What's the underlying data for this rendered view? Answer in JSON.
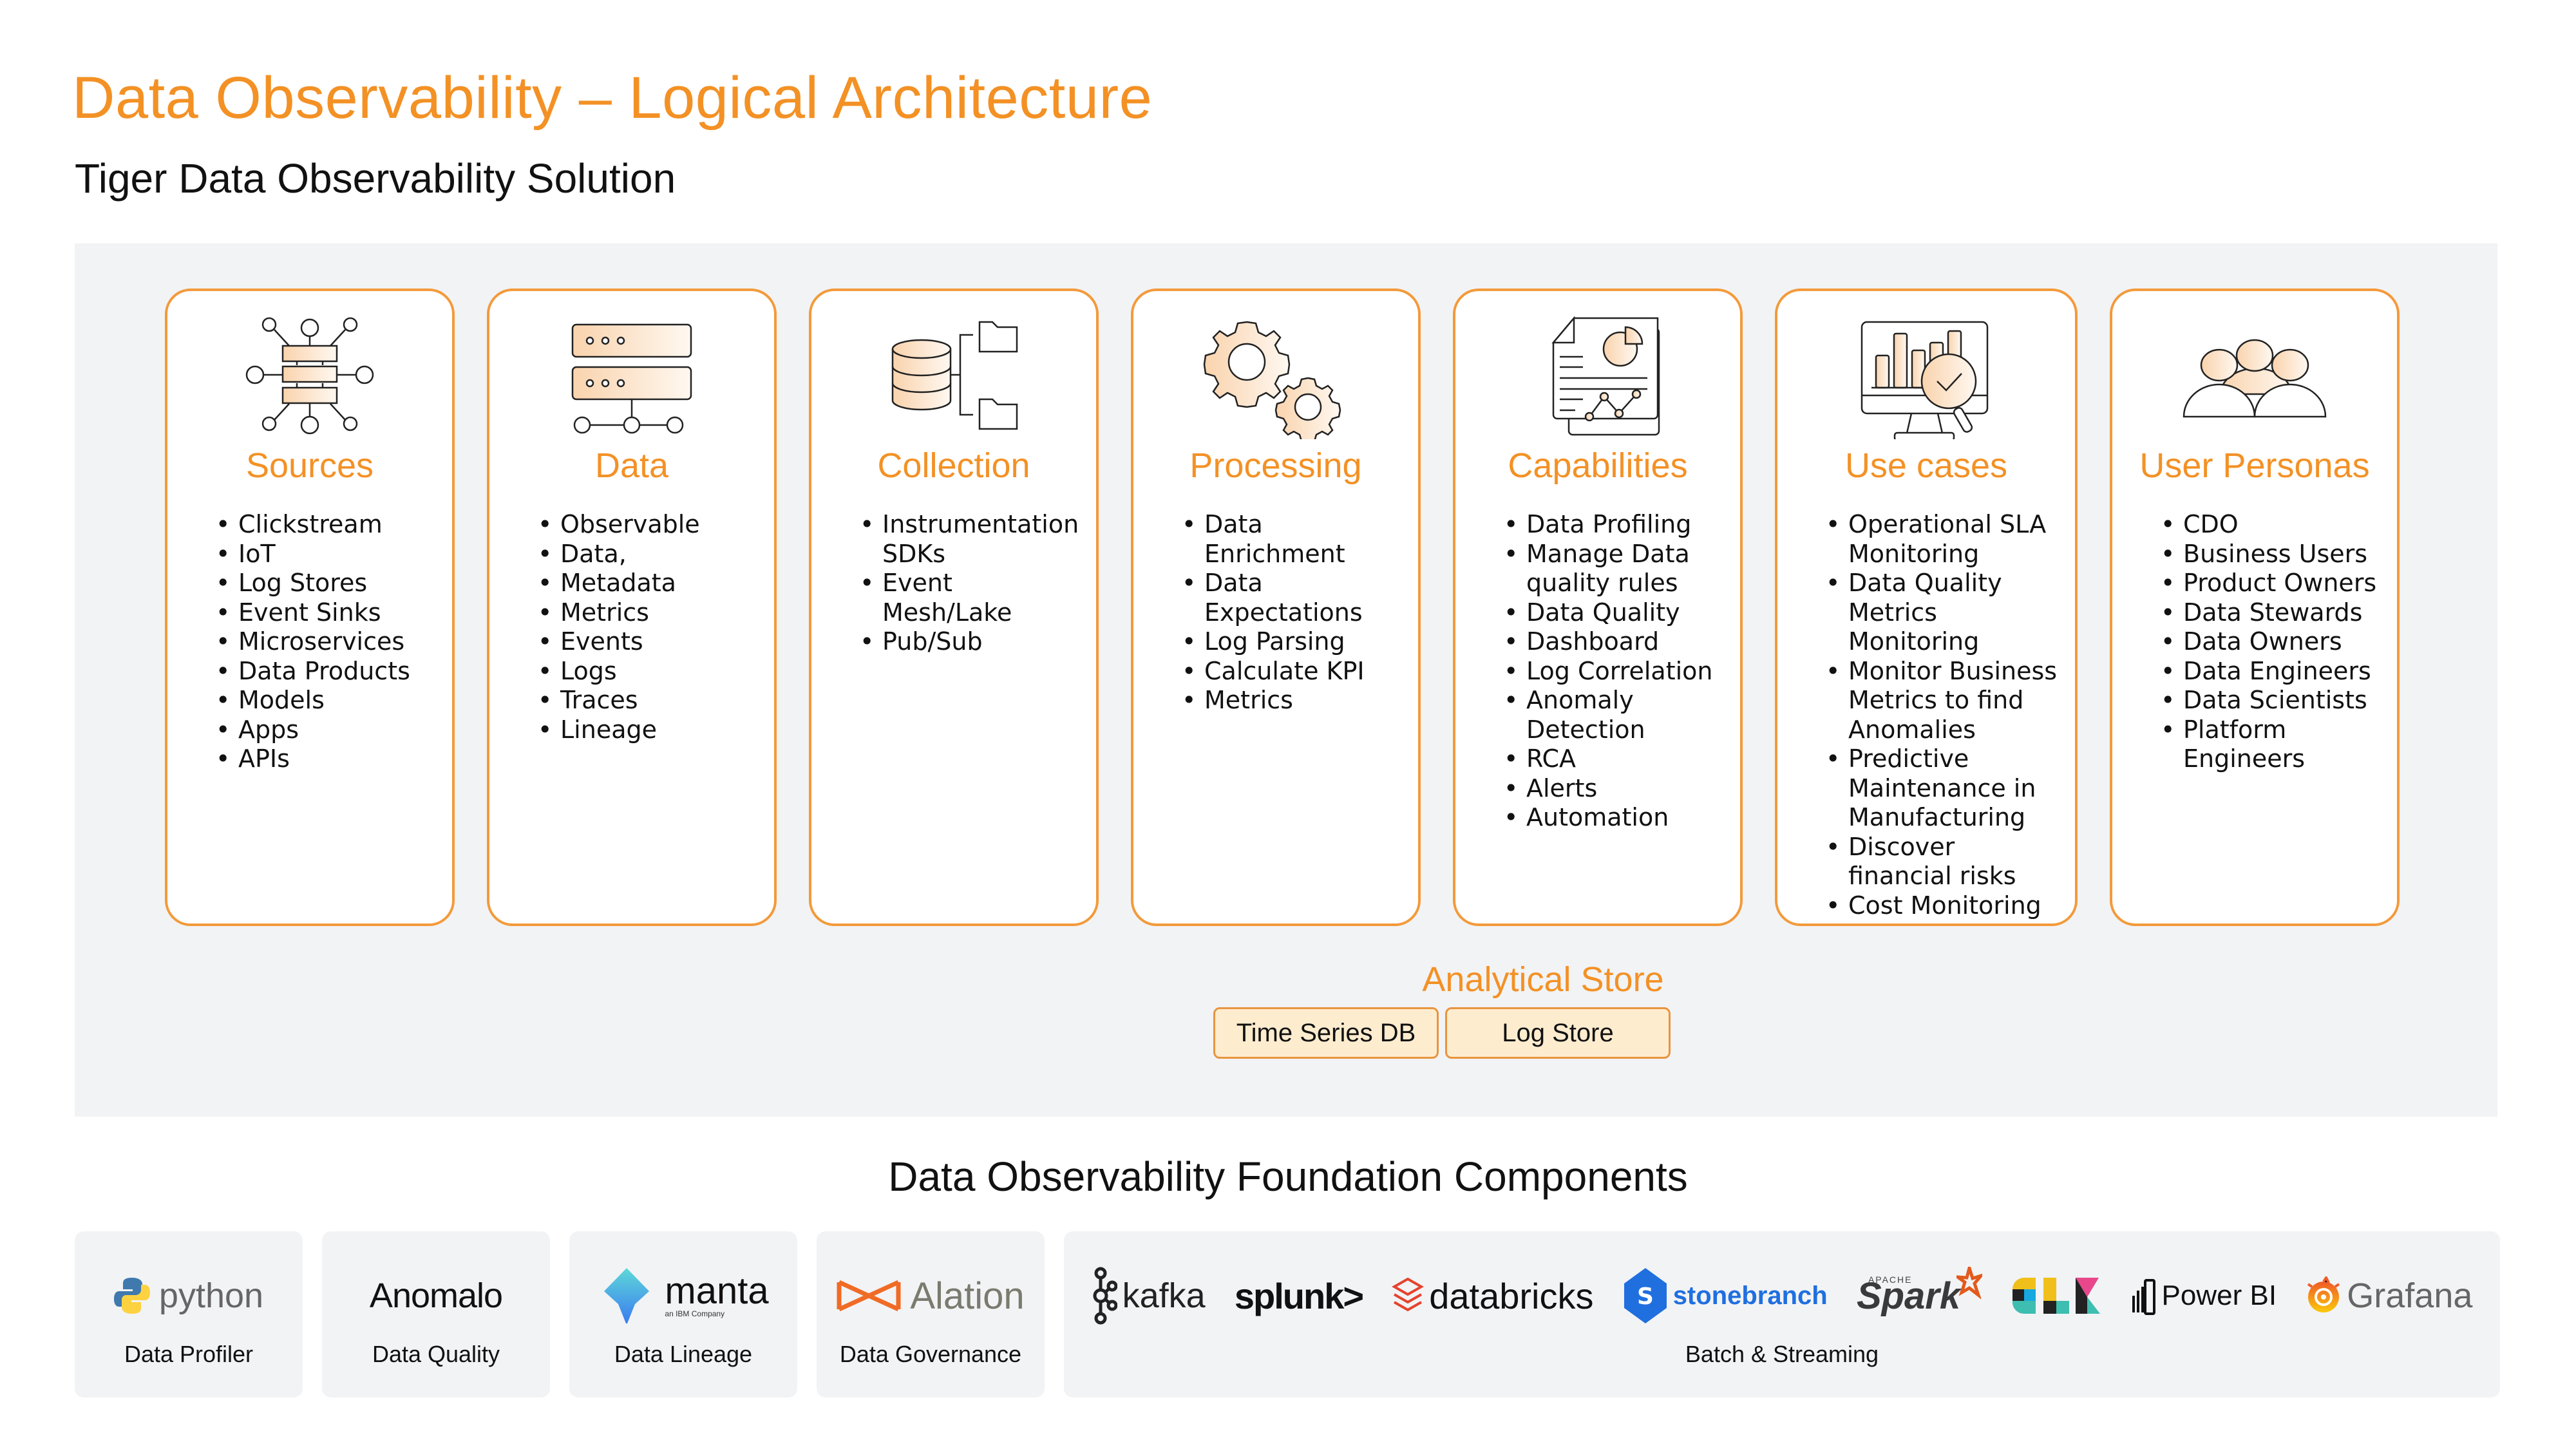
{
  "header": {
    "title": "Data Observability – Logical Architecture",
    "subtitle": "Tiger Data Observability Solution"
  },
  "colors": {
    "accent": "#f39125",
    "card_border": "#f39a3a",
    "panel_bg": "#f2f3f5",
    "store_bg": "#feeccf"
  },
  "columns": [
    {
      "icon": "network-hub-icon",
      "title": "Sources",
      "items": [
        "Clickstream",
        "IoT",
        "Log Stores",
        "Event Sinks",
        "Microservices",
        "Data Products",
        "Models",
        "Apps",
        "APIs"
      ]
    },
    {
      "icon": "server-icon",
      "title": "Data",
      "items": [
        "Observable",
        "Data,",
        "Metadata",
        "Metrics",
        "Events",
        "Logs",
        "Traces",
        "Lineage"
      ]
    },
    {
      "icon": "database-folders-icon",
      "title": "Collection",
      "items": [
        "Instrumentation SDKs",
        "Event Mesh/Lake",
        "Pub/Sub"
      ]
    },
    {
      "icon": "gears-icon",
      "title": "Processing",
      "items": [
        "Data Enrichment",
        "Data Expectations",
        "Log Parsing",
        "Calculate KPI",
        "Metrics"
      ]
    },
    {
      "icon": "report-document-icon",
      "title": "Capabilities",
      "items": [
        "Data Profiling",
        "Manage Data quality rules",
        "Data Quality",
        "Dashboard",
        "Log Correlation",
        "Anomaly Detection",
        "RCA",
        "Alerts",
        "Automation"
      ]
    },
    {
      "icon": "monitor-analytics-icon",
      "title": "Use cases",
      "items": [
        "Operational SLA Monitoring",
        "Data Quality Metrics Monitoring",
        "Monitor Business Metrics to find Anomalies",
        "Predictive Maintenance in Manufacturing",
        "Discover financial risks",
        "Cost Monitoring"
      ]
    },
    {
      "icon": "users-group-icon",
      "title": "User Personas",
      "items": [
        "CDO",
        "Business Users",
        "Product Owners",
        "Data Stewards",
        "Data Owners",
        "Data Engineers",
        "Data Scientists",
        "Platform Engineers"
      ]
    }
  ],
  "analytical_store": {
    "label": "Analytical Store",
    "stores": [
      "Time Series DB",
      "Log Store"
    ]
  },
  "foundation": {
    "title": "Data Observability Foundation Components",
    "components": [
      {
        "logos": [
          "python"
        ],
        "label": "Data Profiler"
      },
      {
        "logos": [
          "Anomalo"
        ],
        "label": "Data Quality"
      },
      {
        "logos": [
          "manta"
        ],
        "sublogo": "an IBM Company",
        "label": "Data Lineage"
      },
      {
        "logos": [
          "Alation"
        ],
        "label": "Data Governance"
      },
      {
        "logos": [
          "kafka",
          "splunk>",
          "databricks",
          "stonebranch",
          "Spark",
          "ELK",
          "Power BI",
          "Grafana"
        ],
        "spark_super": "APACHE",
        "label": "Batch & Streaming"
      }
    ]
  }
}
